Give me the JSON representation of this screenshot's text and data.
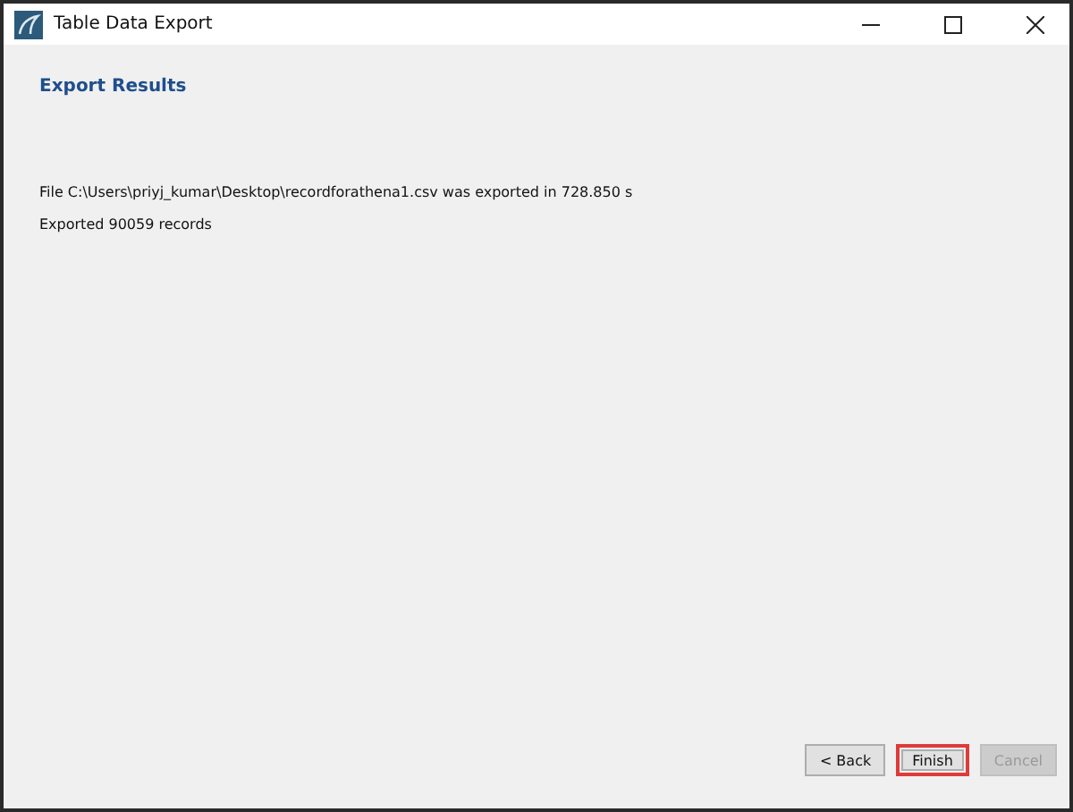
{
  "window": {
    "title": "Table Data Export"
  },
  "heading": "Export Results",
  "messages": [
    "File C:\\Users\\priyj_kumar\\Desktop\\recordforathena1.csv was exported in 728.850 s",
    "Exported 90059 records"
  ],
  "buttons": [
    {
      "label": "< Back",
      "disabled": false,
      "highlighted": false
    },
    {
      "label": "Finish",
      "disabled": false,
      "highlighted": true
    },
    {
      "label": "Cancel",
      "disabled": true,
      "highlighted": false
    }
  ]
}
